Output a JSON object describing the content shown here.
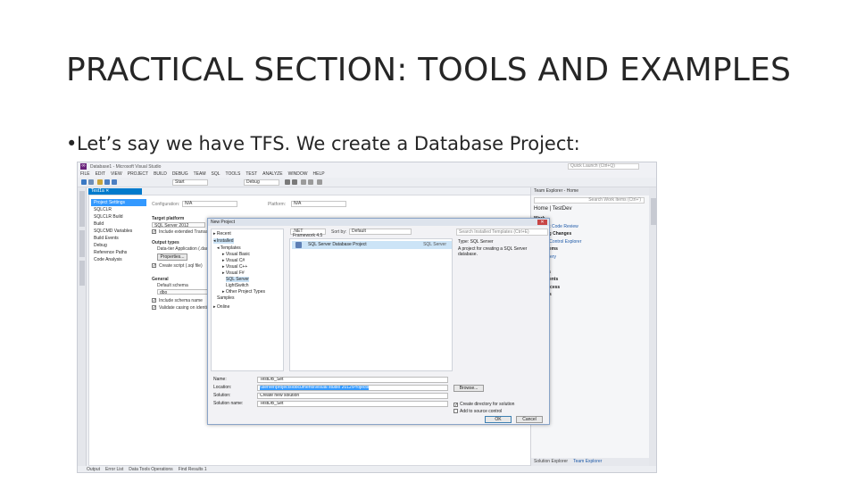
{
  "slide": {
    "title": "PRACTICAL SECTION: TOOLS AND EXAMPLES",
    "bullet": "Let’s say we have TFS. We create a Database Project:"
  },
  "vs": {
    "window_title": "Database1 - Microsoft Visual Studio",
    "quick_launch_placeholder": "Quick Launch (Ctrl+Q)",
    "menu": [
      "FILE",
      "EDIT",
      "VIEW",
      "PROJECT",
      "BUILD",
      "DEBUG",
      "TEAM",
      "SQL",
      "TOOLS",
      "TEST",
      "ANALYZE",
      "WINDOW",
      "HELP"
    ],
    "toolbar": {
      "start_label": "Start",
      "config_label": "Debug"
    },
    "doc_tab": "Test1a ✕",
    "doc_nav": [
      "Project Settings",
      "SQLCLR",
      "SQLCLR Build",
      "Build",
      "SQLCMD Variables",
      "Build Events",
      "Debug",
      "Reference Paths",
      "Code Analysis"
    ],
    "config_row": {
      "configuration_label": "Configuration:",
      "configuration_value": "N/A",
      "platform_label": "Platform:",
      "platform_value": "N/A"
    },
    "props": {
      "target_platform_label": "Target platform",
      "target_platform_value": "SQL Server 2012",
      "include_ext": "Include extended Transact-SQL",
      "output_types": "Output types",
      "dac_label": "Data-tier Application (.dacpac)",
      "properties_btn": "Properties...",
      "create_script": "Create script (.sql file)",
      "general": "General",
      "default_schema": "Default schema",
      "schema_value": "dbo",
      "include_schema": "Include schema name",
      "validate_casing": "Validate casing on identifiers"
    },
    "team_explorer": {
      "header": "Team Explorer - Home",
      "search": "Search Work Items (Ctrl+')",
      "home": "Home | TestDev",
      "items": [
        {
          "text": "Work",
          "kind": "head"
        },
        {
          "text": "Request Code Review",
          "kind": "link"
        },
        {
          "text": "Pending Changes",
          "kind": "head"
        },
        {
          "text": "Source Control Explorer",
          "kind": "link"
        },
        {
          "text": "Work Items",
          "kind": "head"
        },
        {
          "text": "New Query",
          "kind": "link"
        },
        {
          "text": "Builds",
          "kind": "head"
        },
        {
          "text": "Reports",
          "kind": "head"
        },
        {
          "text": "Documents",
          "kind": "head"
        },
        {
          "text": "Web Access",
          "kind": "head"
        },
        {
          "text": "Settings",
          "kind": "head"
        }
      ],
      "bottom_tabs": [
        "Solution Explorer",
        "Team Explorer"
      ]
    },
    "status_tabs": [
      "Output",
      "Error List",
      "Data Tools Operations",
      "Find Results 1"
    ]
  },
  "dialog": {
    "title": "New Project",
    "close": "✕",
    "tree": [
      "▸ Recent",
      "◂ Installed",
      "◂ Templates",
      "▸ Visual Basic",
      "▸ Visual C#",
      "▸ Visual C++",
      "▸ Visual F#",
      "SQL Server",
      "LightSwitch",
      "▸ Other Project Types",
      "Samples",
      "▸ Online"
    ],
    "framework": ".NET Framework 4.5",
    "sort_label": "Sort by:",
    "sort_value": "Default",
    "template_name": "SQL Server Database Project",
    "template_type": "SQL Server",
    "search_placeholder": "Search Installed Templates (Ctrl+E)",
    "desc_type": "Type: SQL Server",
    "desc_text": "A project for creating a SQL Server database.",
    "fields": {
      "name_label": "Name:",
      "name_value": "TestDB_Set",
      "location_label": "Location:",
      "location_value": "\\\\server\\projects\\documents\\visual studio 2012\\Projects",
      "solution_label": "Solution:",
      "solution_value": "Create new solution",
      "solution_name_label": "Solution name:",
      "solution_name_value": "TestDB_Set"
    },
    "browse": "Browse...",
    "create_dir": "Create directory for solution",
    "add_source": "Add to source control",
    "ok": "OK",
    "cancel": "Cancel"
  }
}
